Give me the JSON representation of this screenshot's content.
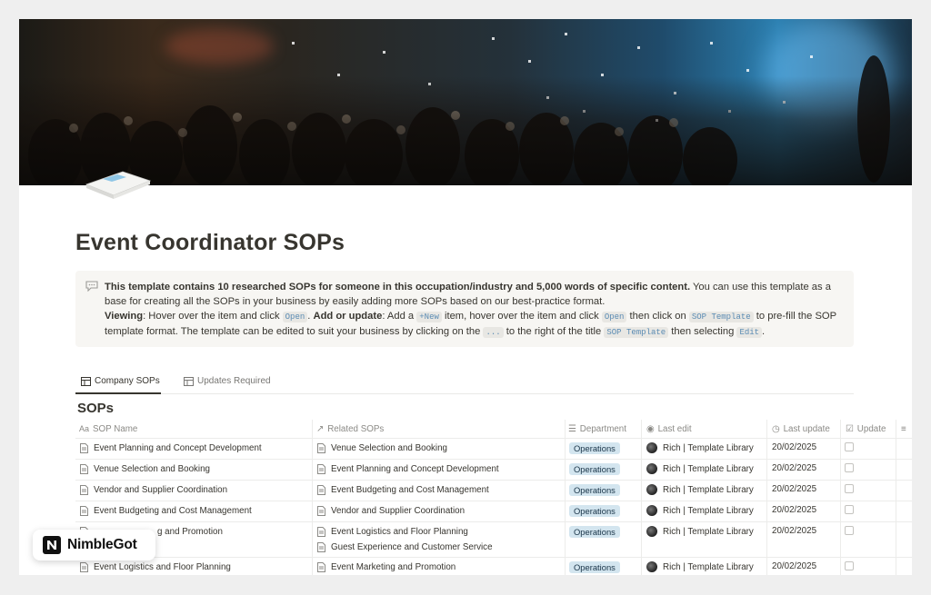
{
  "page": {
    "title": "Event Coordinator SOPs"
  },
  "callout": {
    "bold_intro": "This template contains 10 researched SOPs for someone in this occupation/industry and 5,000 words of specific content.",
    "intro_rest": " You can use this template as a base for creating all the SOPs in your business by easily adding more SOPs based on our best-practice format.",
    "viewing_label": "Viewing",
    "viewing_text_1": ": Hover over the item and click ",
    "open_code": "Open",
    "dot": ".",
    "add_label": "Add or update",
    "add_text_1": ": Add a ",
    "new_code": "+New",
    "add_text_2": " item, hover over the item and click ",
    "open_code_2": "Open",
    "add_text_3": " then click on ",
    "sop_template_code": "SOP Template",
    "add_text_4": " to pre-fill the SOP template format. The template can be edited to suit your business by clicking on the ",
    "ellipsis_code": "...",
    "add_text_5": " to the right of the title ",
    "sop_template_code_2": "SOP Template",
    "add_text_6": " then selecting ",
    "edit_code": "Edit",
    "end": "."
  },
  "tabs": [
    {
      "label": "Company SOPs",
      "active": true
    },
    {
      "label": "Updates Required",
      "active": false
    }
  ],
  "database": {
    "title": "SOPs",
    "columns": [
      "SOP Name",
      "Related SOPs",
      "Department",
      "Last edit",
      "Last update",
      "Update"
    ],
    "rows": [
      {
        "name": "Event Planning and Concept Development",
        "related": [
          "Venue Selection and Booking"
        ],
        "department": "Operations",
        "last_edit": "Rich | Template Library",
        "last_update": "20/02/2025"
      },
      {
        "name": "Venue Selection and Booking",
        "related": [
          "Event Planning and Concept Development"
        ],
        "department": "Operations",
        "last_edit": "Rich | Template Library",
        "last_update": "20/02/2025"
      },
      {
        "name": "Vendor and Supplier Coordination",
        "related": [
          "Event Budgeting and Cost Management"
        ],
        "department": "Operations",
        "last_edit": "Rich | Template Library",
        "last_update": "20/02/2025"
      },
      {
        "name": "Event Budgeting and Cost Management",
        "related": [
          "Vendor and Supplier Coordination"
        ],
        "department": "Operations",
        "last_edit": "Rich | Template Library",
        "last_update": "20/02/2025"
      },
      {
        "name": "g and Promotion",
        "related": [
          "Event Logistics and Floor Planning",
          "Guest Experience and Customer Service"
        ],
        "department": "Operations",
        "last_edit": "Rich | Template Library",
        "last_update": "20/02/2025"
      },
      {
        "name": "Event Logistics and Floor Planning",
        "related": [
          "Event Marketing and Promotion"
        ],
        "department": "Operations",
        "last_edit": "Rich | Template Library",
        "last_update": "20/02/2025"
      }
    ]
  },
  "watermark": {
    "brand": "NimbleGot"
  },
  "colors": {
    "tag_bg": "#d3e5ef",
    "tag_text": "#183347",
    "callout_bg": "#f7f6f3"
  }
}
